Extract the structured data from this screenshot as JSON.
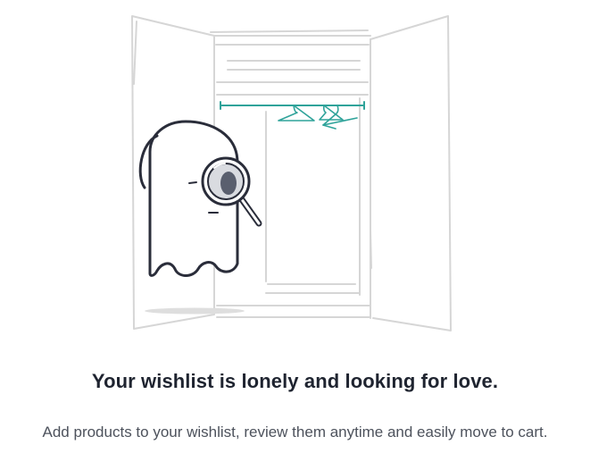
{
  "empty_state": {
    "illustration_icon": "ghost-with-magnifier-in-empty-wardrobe",
    "title": "Your wishlist is lonely and looking for love.",
    "message": "Add products to your wishlist, review them anytime and easily move to cart."
  },
  "colors": {
    "wardrobe_line": "#d6d6d6",
    "rail_accent": "#2fa39a",
    "ghost_outline": "#2a2d3a",
    "ghost_fill": "#ffffff",
    "lens_fill": "#d9dbe0",
    "pupil": "#5a5f6e",
    "shadow": "#dedede",
    "title_text": "#1f2430",
    "body_text": "#4d525c"
  }
}
